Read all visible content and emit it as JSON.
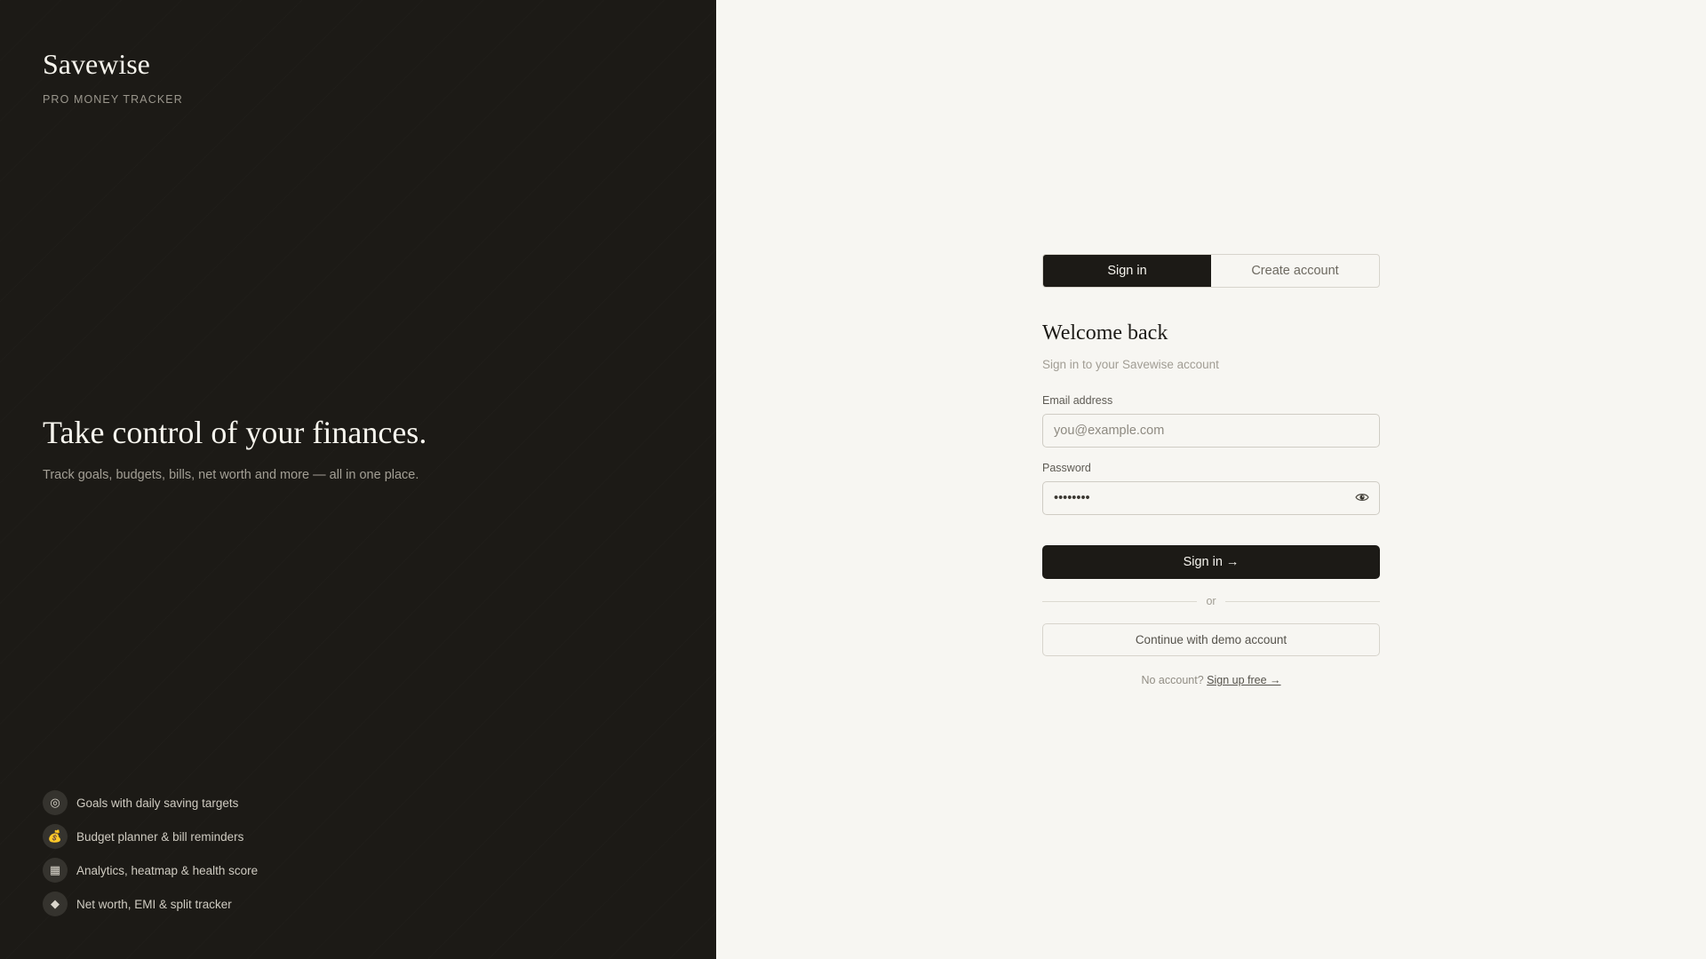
{
  "brand": {
    "name": "Savewise",
    "tagline": "PRO MONEY TRACKER"
  },
  "hero": {
    "title": "Take control of your finances.",
    "subtitle": "Track goals, budgets, bills, net worth and more — all in one place."
  },
  "features": [
    {
      "icon": "◎",
      "icon_name": "target-icon",
      "label": "Goals with daily saving targets"
    },
    {
      "icon": "💰",
      "icon_name": "money-bag-icon",
      "label": "Budget planner & bill reminders"
    },
    {
      "icon": "▦",
      "icon_name": "chart-icon",
      "label": "Analytics, heatmap & health score"
    },
    {
      "icon": "◆",
      "icon_name": "diamond-icon",
      "label": "Net worth, EMI & split tracker"
    }
  ],
  "tabs": [
    {
      "label": "Sign in",
      "active": true
    },
    {
      "label": "Create account",
      "active": false
    }
  ],
  "form": {
    "heading": "Welcome back",
    "subheading": "Sign in to your Savewise account",
    "email_label": "Email address",
    "email_placeholder": "you@example.com",
    "email_value": "",
    "password_label": "Password",
    "password_value": "••••••••",
    "show_password_icon": "eye-icon",
    "submit_label": "Sign in →",
    "divider_text": "or",
    "demo_label": "Continue with demo account",
    "footer_text": "No account?",
    "footer_link": "Sign up free →"
  },
  "colors": {
    "dark": "#1c1a16",
    "light": "#f7f6f2",
    "muted": "#a19d94"
  }
}
